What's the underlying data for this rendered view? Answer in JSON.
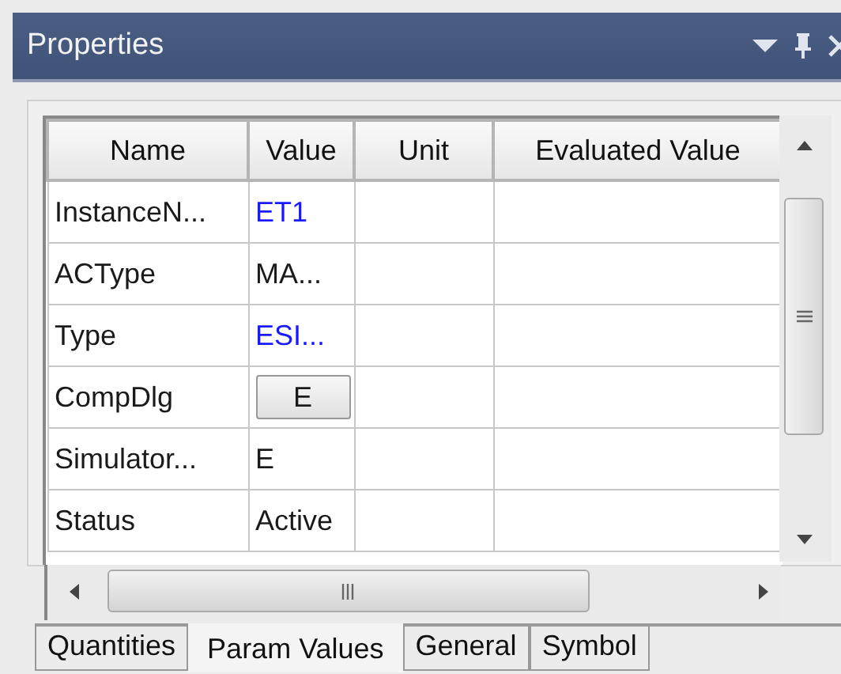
{
  "window": {
    "title": "Properties"
  },
  "table": {
    "columns": [
      "Name",
      "Value",
      "Unit",
      "Evaluated Value"
    ],
    "rows": [
      {
        "name": "InstanceN...",
        "value": {
          "text": "ET1",
          "kind": "text",
          "color": "#1a1aff"
        }
      },
      {
        "name": "ACType",
        "value": {
          "text": "MA...",
          "kind": "text",
          "color": "#1a1a1a"
        }
      },
      {
        "name": "Type",
        "value": {
          "text": "ESI...",
          "kind": "text",
          "color": "#1a1aff"
        }
      },
      {
        "name": "CompDlg",
        "value": {
          "text": "E",
          "kind": "button",
          "color": "#1a1a1a"
        }
      },
      {
        "name": "Simulator...",
        "value": {
          "text": "E",
          "kind": "text",
          "color": "#1a1a1a"
        }
      },
      {
        "name": "Status",
        "value": {
          "text": "Active",
          "kind": "text",
          "color": "#1a1a1a"
        }
      }
    ]
  },
  "tabs": [
    {
      "label": "Quantities",
      "selected": false
    },
    {
      "label": "Param Values",
      "selected": true
    },
    {
      "label": "General",
      "selected": false
    },
    {
      "label": "Symbol",
      "selected": false
    }
  ]
}
